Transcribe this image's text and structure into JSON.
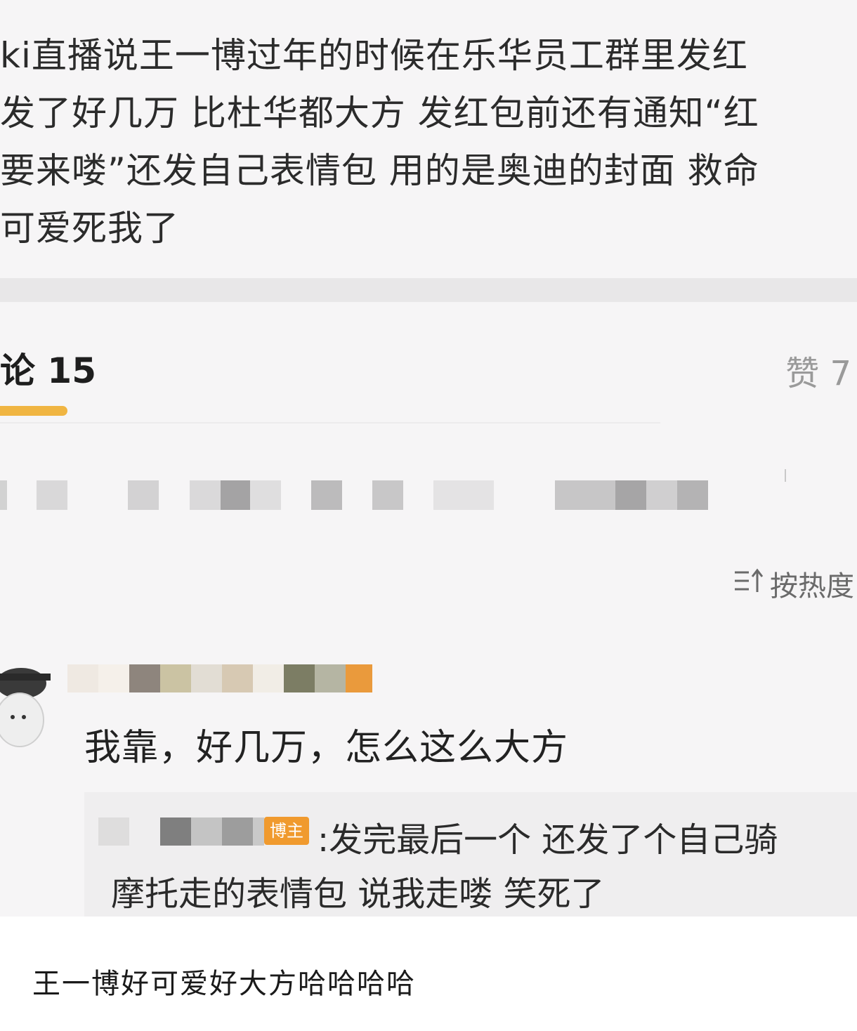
{
  "post": {
    "lines": [
      "ki直播说王一博过年的时候在乐华员工群里发红",
      "发了好几万 比杜华都大方 发红包前还有通知“红",
      "要来喽”还发自己表情包 用的是奥迪的封面 救命",
      "可爱死我了"
    ]
  },
  "tabs": {
    "comments": "论 15",
    "likes": "赞 7"
  },
  "sort": {
    "label": "按热度",
    "icon": "sort-hot-icon"
  },
  "comment": {
    "text": "我靠，好几万，怎么这么大方",
    "reply": {
      "badge": "博主",
      "line1": ":发完最后一个 还发了个自己骑",
      "line2": "摩托走的表情包 说我走喽 笑死了"
    }
  },
  "caption": "王一博好可爱好大方哈哈哈哈",
  "colors": {
    "accent": "#f0b542",
    "badge": "#f09a2e",
    "background": "#f6f5f6"
  }
}
